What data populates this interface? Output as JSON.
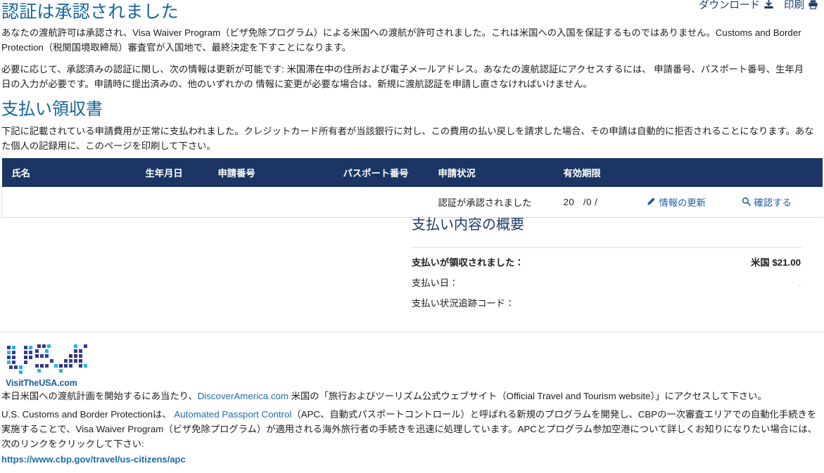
{
  "utility": {
    "download_label": "ダウンロード",
    "print_label": "印刷",
    "download_icon": "download-icon",
    "print_icon": "printer-icon"
  },
  "approved": {
    "title": "認証は承認されました",
    "paragraph_1": "あなたの渡航許可は承認され、Visa Waiver Program（ビザ免除プログラム）による米国への渡航が許可されました。これは米国への入国を保証するものではありません。Customs and Border Protection（税関国境取締局）審査官が入国地で、最終決定を下すことになります。",
    "paragraph_2": "必要に応じて、承認済みの認証に関し、次の情報は更新が可能です: 米国滞在中の住所および電子メールアドレス。あなたの渡航認証にアクセスするには、 申請番号、パスポート番号、生年月日の入力が必要です。申請時に提出済みの、他のいずれかの 情報に変更が必要な場合は、新規に渡航認証を申請し直さなければいけません。"
  },
  "receipt": {
    "title": "支払い領収書",
    "paragraph": "下記に記載されている申請費用が正常に支払われました。クレジットカード所有者が当該銀行に対し、この費用の払い戻しを請求した場合、その申請は自動的に拒否されることになります。あなた個人の記録用に、このページを印刷して下さい。"
  },
  "table": {
    "headers": [
      "氏名",
      "生年月日",
      "申請番号",
      "パスポート番号",
      "申請状況",
      "有効期限",
      "",
      ""
    ],
    "row": {
      "name": "",
      "dob": "",
      "application_number": "",
      "passport_number": "",
      "status": "認証が承認されました",
      "expiration": "20   /0 /",
      "update_label": "情報の更新",
      "update_icon": "pencil-icon",
      "verify_label": "確認する",
      "verify_icon": "magnifier-icon"
    }
  },
  "summary": {
    "title": "支払い内容の概要",
    "rows": [
      {
        "label": "支払いが領収されました：",
        "value": "米国 $21.00",
        "bold": true
      },
      {
        "label": "支払い日：",
        "value": ".",
        "bold": false
      },
      {
        "label": "支払い状況追跡コード：",
        "value": "",
        "bold": false
      }
    ]
  },
  "logo": {
    "wordmark": "VisitTheUSA.com",
    "alt": "usa-dots-logo"
  },
  "footer": {
    "paragraph_1_before": "本日米国への渡航計画を開始するにあ当たり、",
    "paragraph_1_link": "DiscoverAmerica.com",
    "paragraph_1_after": " 米国の「旅行およびツーリズム公式ウェブサイト（Official Travel and Tourism website）」にアクセスして下さい。",
    "paragraph_2_before": "U.S. Customs and Border Protectionは、 ",
    "paragraph_2_link": "Automated Passport Control",
    "paragraph_2_after": "（APC、自動式パスポートコントロール）と呼ばれる新規のプログラムを開発し、CBPの一次審査エリアでの自動化手続きを実施することで、Visa Waiver Program（ビザ免除プログラム）が適用される海外旅行者の手続きを迅速に処理しています。APCとプログラム参加空港について詳しくお知りになりたい場合には、次のリンクをクリックして下さい:",
    "link_url": "https://www.cbp.gov/travel/us-citizens/apc"
  },
  "colors": {
    "table_header_bg": "#1b3664",
    "heading_blue": "#166697",
    "link_blue": "#1b6ca8",
    "summary_heading": "#1c3a6b"
  }
}
